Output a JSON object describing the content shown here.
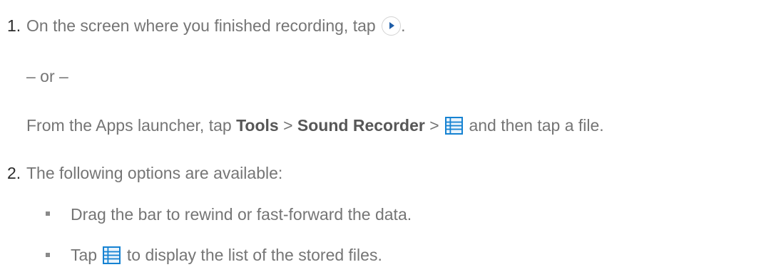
{
  "steps": [
    {
      "number": "1.",
      "line1_before": "On the screen where you finished recording, tap",
      "line1_after": ".",
      "or_text": "– or –",
      "alt_prefix": "From the Apps launcher, tap",
      "alt_tools": "Tools",
      "alt_sep1": ">",
      "alt_sound_recorder": "Sound Recorder",
      "alt_sep2": ">",
      "alt_suffix": "and then tap a file."
    },
    {
      "number": "2.",
      "text": "The following options are available:",
      "bullets": [
        {
          "text": "Drag the bar to rewind or fast-forward the data."
        },
        {
          "tap": "Tap",
          "after_icon": "to display the list of the stored files."
        }
      ]
    }
  ],
  "icons": {
    "play": "play-circle-icon",
    "list": "list-view-icon"
  },
  "colors": {
    "body_text": "#757575",
    "number_text": "#2b2b2b",
    "bold_text": "#575757",
    "icon_blue": "#1582d2"
  }
}
